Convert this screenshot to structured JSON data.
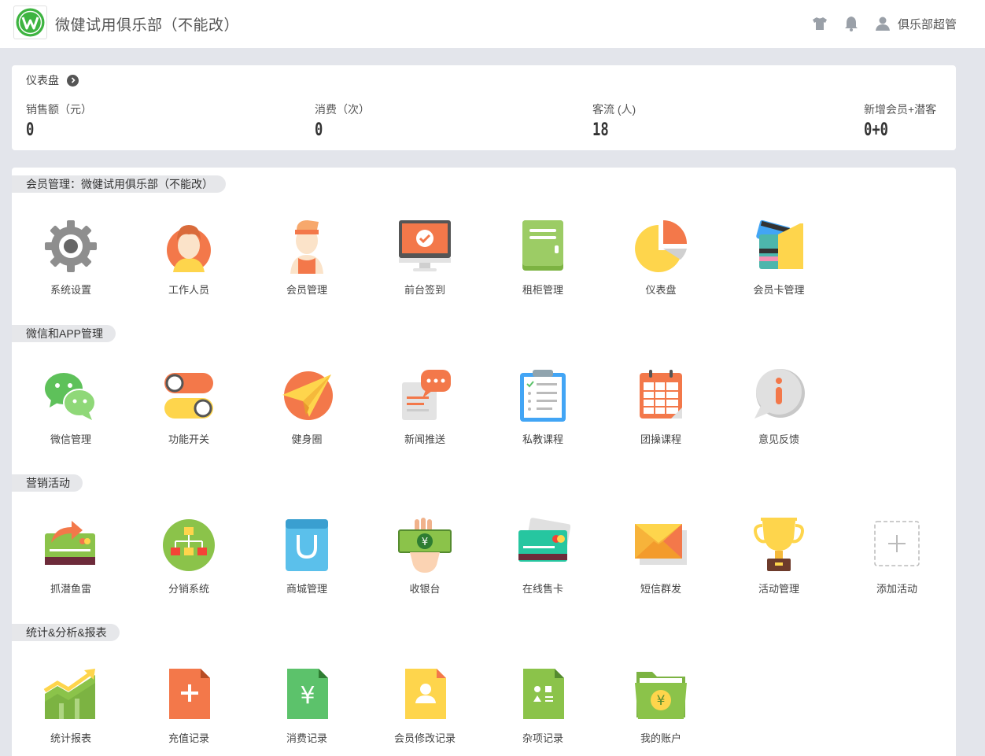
{
  "header": {
    "title": "微健试用俱乐部（不能改）",
    "user": "俱乐部超管",
    "icons": [
      "shirt-icon",
      "bell-icon",
      "user-icon"
    ]
  },
  "dashboard": {
    "title": "仪表盘",
    "stats": [
      {
        "label": "销售额（元）",
        "value": "0"
      },
      {
        "label": "消费（次）",
        "value": "0"
      },
      {
        "label": "客流 (人)",
        "value": "18"
      },
      {
        "label": "新增会员+潜客",
        "value": "0+0"
      }
    ]
  },
  "sections": [
    {
      "title": "会员管理：微健试用俱乐部（不能改）",
      "items": [
        "系统设置",
        "工作人员",
        "会员管理",
        "前台签到",
        "租柜管理",
        "仪表盘",
        "会员卡管理"
      ]
    },
    {
      "title": "微信和APP管理",
      "items": [
        "微信管理",
        "功能开关",
        "健身圈",
        "新闻推送",
        "私教课程",
        "团操课程",
        "意见反馈"
      ]
    },
    {
      "title": "营销活动",
      "items": [
        "抓潜鱼雷",
        "分销系统",
        "商城管理",
        "收银台",
        "在线售卡",
        "短信群发",
        "活动管理",
        "添加活动"
      ]
    },
    {
      "title": "统计&分析&报表",
      "items": [
        "统计报表",
        "充值记录",
        "消费记录",
        "会员修改记录",
        "杂项记录",
        "我的账户"
      ]
    }
  ],
  "colors": {
    "logo_green": "#3eb441",
    "orange": "#f3784a",
    "yellow": "#fed54c",
    "green": "#5cc26b"
  }
}
